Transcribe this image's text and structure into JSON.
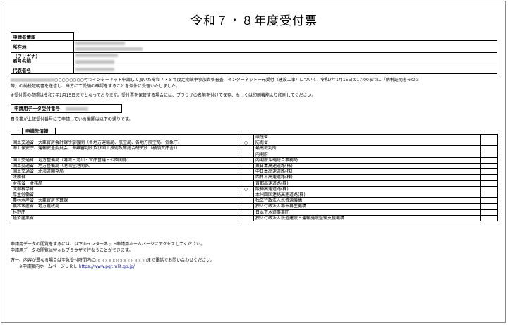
{
  "title": "令和７・８年度受付票",
  "applicant": {
    "header": "申請者情報",
    "rows": [
      {
        "label": "所在地",
        "value": "〒000-0000　東京都○○区○○町一丁目1番1号"
      },
      {
        "label": "（フリガナ）\n商号名称",
        "value": "カブシキガイシャ○○○○\n株式会社○○○○"
      },
      {
        "label": "代表者名",
        "value": "代表取締役　○○○○"
      }
    ]
  },
  "notice": {
    "line1": "○○○○○○○○付でインターネット申請して頂いた令和７・８年度定期競争参加資格審査　インターネット一元受付（建設工事）について、令和7年1月15日の17:00までに「納税証明書その３",
    "line2": "等」の納税証明書を送信し、当方にて受領の確認をすることを条件に受理いたしました。",
    "line3": "※受付票の参照は令和7年1月15日までとなっております。受付票を保管する場合には、ブラウザの名前を付けて保存、もしくは印刷機能より印刷してください。"
  },
  "receipt": {
    "label": "申請用データ受付番号",
    "value": "○○○○○○"
  },
  "creditor_note": "貴企業が上記受付番号にて申請している機関は以下の通りです。",
  "destinations": {
    "header": "申請先情報",
    "rows": [
      {
        "left": "",
        "mark": "",
        "right": "環境省"
      },
      {
        "left": "国土交通省　大臣官房会計課所掌機関（各地方運輸局、航空局、各地方航空局、気象庁、",
        "mark": "○",
        "right": "防衛省"
      },
      {
        "left": "海上保安庁、運輸安全委員会、海難審判所及び国土技術政策総合研究所（横須賀庁舎））",
        "mark": "",
        "right": "最高裁判所"
      },
      {
        "left": "",
        "mark": "",
        "right": "内閣府"
      },
      {
        "left": "国土交通省　地方整備局（港湾・河川・官庁営繕・公園関係）",
        "mark": "",
        "right": "内閣府沖縄総合事務局"
      },
      {
        "left": "国土交通省　地方整備局（港湾空港関係）",
        "mark": "",
        "right": "東日本高速道路(株)"
      },
      {
        "left": "国土交通省　北海道開発局",
        "mark": "",
        "right": "中日本高速道路(株)"
      },
      {
        "left": "法務省",
        "mark": "",
        "right": "西日本高速道路(株)"
      },
      {
        "left": "財務省　財務局",
        "mark": "",
        "right": "首都高速道路(株)"
      },
      {
        "left": "文部科学省",
        "mark": "○",
        "right": "阪神高速道路(株)"
      },
      {
        "left": "厚生労働省",
        "mark": "",
        "right": "本州四国連絡高速道路(株)"
      },
      {
        "left": "農林水産省　大臣官房予算課",
        "mark": "",
        "right": "独立行政法人水資源機構"
      },
      {
        "left": "農林水産省　地方農政局",
        "mark": "",
        "right": "独立行政法人都市再生機構"
      },
      {
        "left": "林野庁",
        "mark": "",
        "right": "日本下水道事業団"
      },
      {
        "left": "経済産業省",
        "mark": "",
        "right": "独立行政法人鉄道建設・運輸施設整備支援機構"
      }
    ]
  },
  "footer": {
    "line1": "申請用データの閲覧をするには、以下のインターネット申請用ホームページにアクセスしてください。",
    "line2": "申請用データの閲覧はＷｅｂブラウザで行なうことができます。",
    "line3a": "万一、内容が異なる場合は至急受付時間内に○○○○○○○○○○○○○○まで電話でお問い合わせください。",
    "line4_label": "※申請案内ホームページＵＲＬ",
    "url": "https://www.pqr.mlit.go.jp/"
  }
}
